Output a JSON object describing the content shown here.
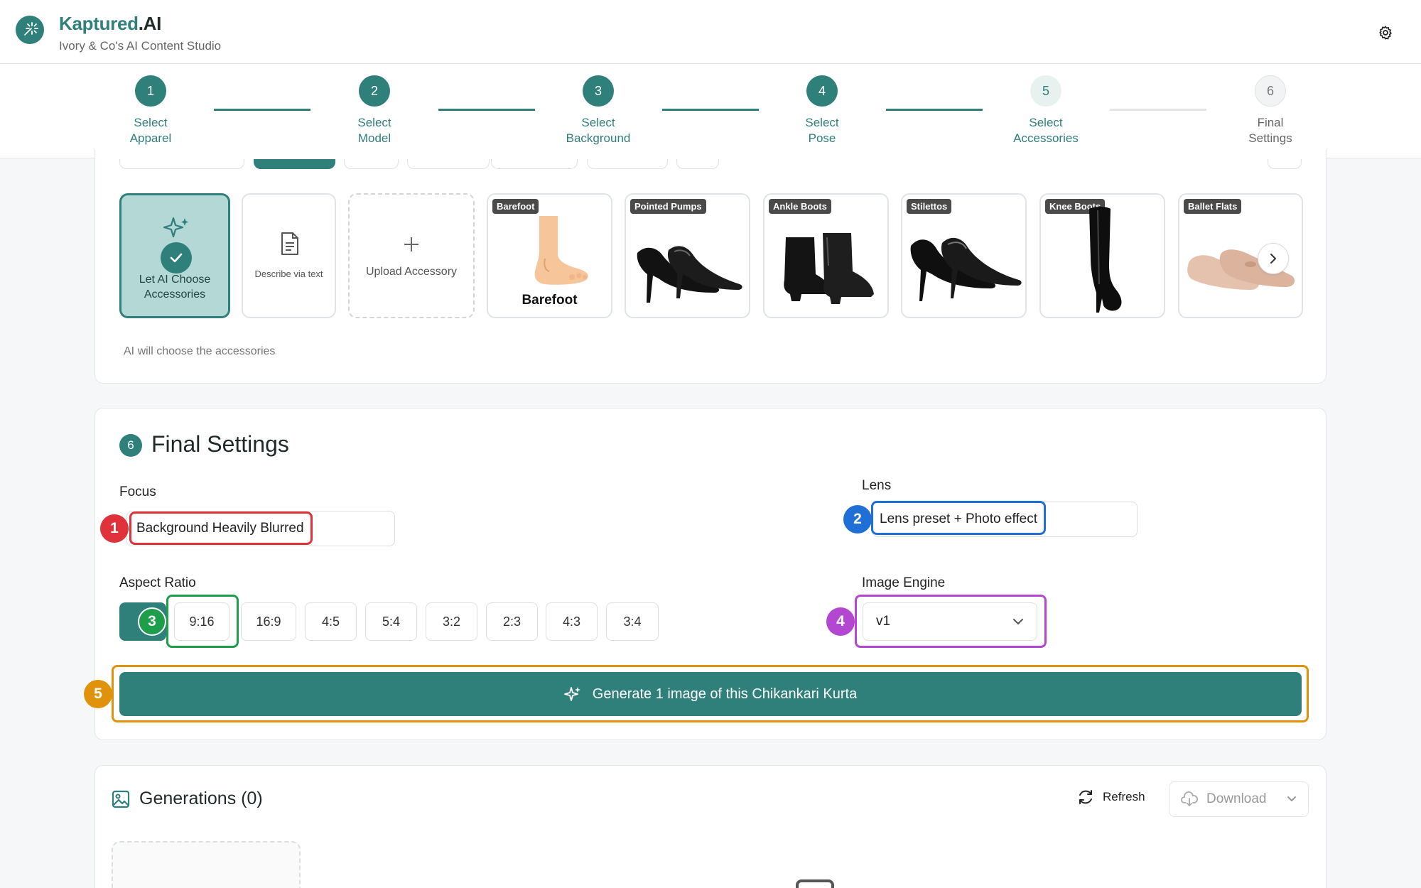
{
  "header": {
    "brand_main": "Kaptured",
    "brand_suffix": ".AI",
    "subtitle": "Ivory & Co's AI Content Studio",
    "logo_icon": "wand-sparkle-icon",
    "settings_icon": "gear-icon"
  },
  "stepper": {
    "steps": [
      {
        "num": "1",
        "line1": "Select",
        "line2": "Apparel",
        "state": "done"
      },
      {
        "num": "2",
        "line1": "Select",
        "line2": "Model",
        "state": "done"
      },
      {
        "num": "3",
        "line1": "Select",
        "line2": "Background",
        "state": "done"
      },
      {
        "num": "4",
        "line1": "Select",
        "line2": "Pose",
        "state": "done"
      },
      {
        "num": "5",
        "line1": "Select",
        "line2": "Accessories",
        "state": "current"
      },
      {
        "num": "6",
        "line1": "Final",
        "line2": "Settings",
        "state": "upcoming"
      }
    ]
  },
  "accessories": {
    "ai_choose_label_1": "Let AI Choose",
    "ai_choose_label_2": "Accessories",
    "describe_label": "Describe via text",
    "upload_label": "Upload Accessory",
    "items": [
      {
        "tag": "Barefoot",
        "caption": "Barefoot"
      },
      {
        "tag": "Pointed Pumps"
      },
      {
        "tag": "Ankle Boots"
      },
      {
        "tag": "Stilettos"
      },
      {
        "tag": "Knee Boots"
      },
      {
        "tag": "Ballet Flats"
      }
    ],
    "note": "AI will choose the accessories"
  },
  "final_settings": {
    "number": "6",
    "title": "Final Settings",
    "focus_label": "Focus",
    "focus_value": "Background Heavily Blurred",
    "lens_label": "Lens",
    "lens_value": "Lens preset + Photo effect",
    "aspect_label": "Aspect Ratio",
    "aspect_ratios": [
      "9:16",
      "16:9",
      "4:5",
      "5:4",
      "3:2",
      "2:3",
      "4:3",
      "3:4"
    ],
    "engine_label": "Image Engine",
    "engine_value": "v1",
    "generate_label": "Generate 1 image of this Chikankari Kurta"
  },
  "annotations": {
    "badges": [
      "1",
      "2",
      "3",
      "4",
      "5"
    ],
    "colors": {
      "red": "#e0323a",
      "blue": "#1f6fd6",
      "green": "#1e9e4a",
      "purple": "#b347d1",
      "orange": "#e0920c"
    }
  },
  "generations": {
    "title": "Generations (0)",
    "refresh_label": "Refresh",
    "download_label": "Download"
  },
  "theme": {
    "accent": "#2f7f7b"
  }
}
